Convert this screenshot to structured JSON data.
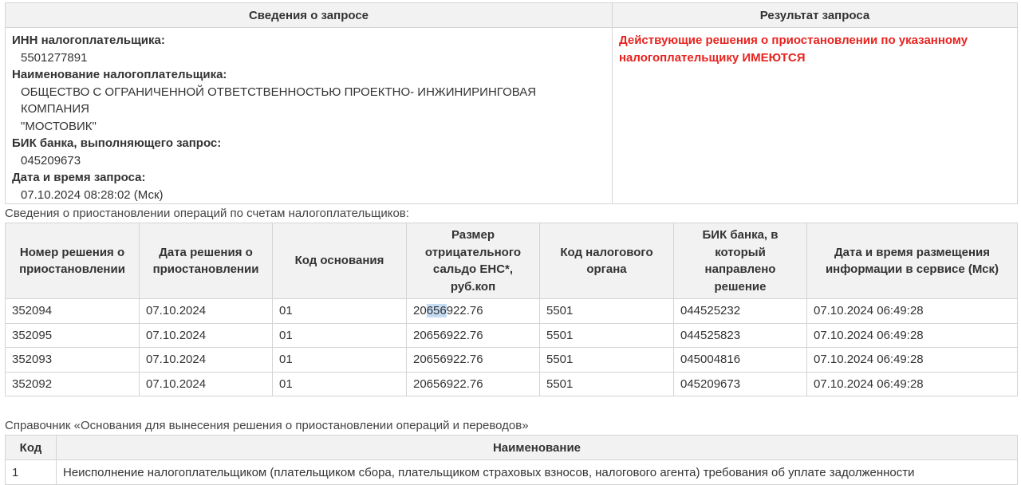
{
  "request": {
    "header_left": "Сведения о запросе",
    "header_right": "Результат запроса",
    "inn_label": "ИНН налогоплательщика:",
    "inn_value": "5501277891",
    "name_label": "Наименование налогоплательщика:",
    "name_value_line1": "ОБЩЕСТВО С ОГРАНИЧЕННОЙ ОТВЕТСТВЕННОСТЬЮ ПРОЕКТНО- ИНЖИНИРИНГОВАЯ КОМПАНИЯ",
    "name_value_line2": "\"МОСТОВИК\"",
    "bik_label": "БИК банка, выполняющего запрос:",
    "bik_value": "045209673",
    "datetime_label": "Дата и время запроса:",
    "datetime_value": "07.10.2024 08:28:02 (Мск)",
    "result_line1": "Действующие решения о приостановлении по указанному",
    "result_line2": "налогоплательщику ИМЕЮТСЯ"
  },
  "operations": {
    "caption": "Сведения о приостановлении операций по счетам налогоплательщиков:",
    "headers": [
      "Номер решения о приостановлении",
      "Дата решения о приостановлении",
      "Код основания",
      "Размер отрицательного сальдо ЕНС*, руб.коп",
      "Код налогового органа",
      "БИК банка, в который направлено решение",
      "Дата и время размещения информации в сервисе (Мск)"
    ],
    "rows": [
      [
        "352094",
        "07.10.2024",
        "01",
        "20656922.76",
        "5501",
        "044525232",
        "07.10.2024 06:49:28"
      ],
      [
        "352095",
        "07.10.2024",
        "01",
        "20656922.76",
        "5501",
        "044525823",
        "07.10.2024 06:49:28"
      ],
      [
        "352093",
        "07.10.2024",
        "01",
        "20656922.76",
        "5501",
        "045004816",
        "07.10.2024 06:49:28"
      ],
      [
        "352092",
        "07.10.2024",
        "01",
        "20656922.76",
        "5501",
        "045209673",
        "07.10.2024 06:49:28"
      ]
    ],
    "first_row_amount_parts": [
      "20",
      "656",
      "922.76"
    ]
  },
  "reference": {
    "caption": "Справочник «Основания для вынесения решения о приостановлении операций и переводов»",
    "headers": [
      "Код",
      "Наименование"
    ],
    "rows": [
      [
        "1",
        "Неисполнение налогоплательщиком (плательщиком сбора, плательщиком страховых взносов, налогового агента) требования об уплате задолженности"
      ]
    ]
  },
  "colors": {
    "result_text": "#e8231e",
    "header_bg": "#f2f2f2",
    "border": "#d4d4d4",
    "selection_highlight": "#c6dcf5"
  }
}
